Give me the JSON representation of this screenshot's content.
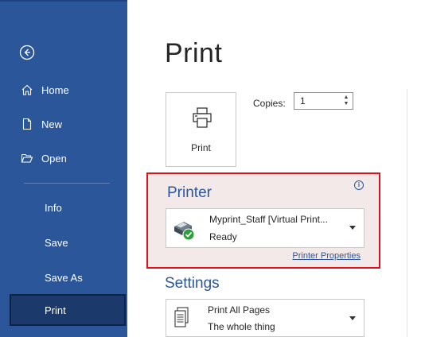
{
  "sidebar": {
    "back_icon": "back-arrow-circle-icon",
    "items": [
      {
        "label": "Home",
        "icon": "home-icon"
      },
      {
        "label": "New",
        "icon": "new-document-icon"
      },
      {
        "label": "Open",
        "icon": "open-folder-icon"
      },
      {
        "label": "Info"
      },
      {
        "label": "Save"
      },
      {
        "label": "Save As"
      },
      {
        "label": "Print",
        "selected": true
      }
    ]
  },
  "main": {
    "title": "Print",
    "print_button_label": "Print",
    "copies_label": "Copies:",
    "copies_value": "1"
  },
  "printer": {
    "heading": "Printer",
    "name": "Myprint_Staff [Virtual Print...",
    "status": "Ready",
    "properties_link": "Printer Properties"
  },
  "settings": {
    "heading": "Settings",
    "pages_option": "Print All Pages",
    "pages_description": "The whole thing"
  },
  "colors": {
    "sidebar_bg": "#2b579a",
    "accent": "#2b579a",
    "highlight_border": "#e0101a",
    "highlight_bg": "#f3e9e9",
    "ready_check": "#2e9e3b"
  }
}
